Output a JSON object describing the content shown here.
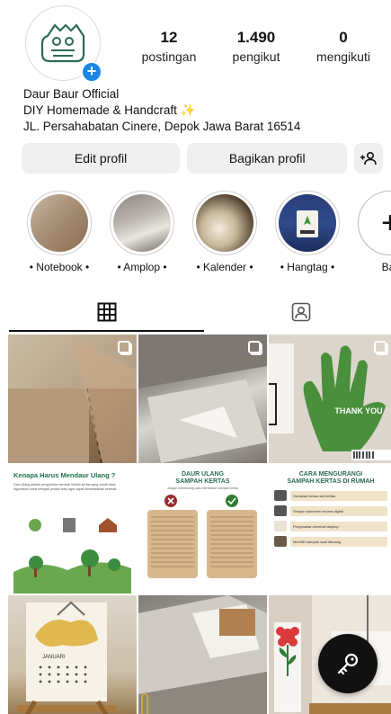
{
  "profile": {
    "name": "Daur Baur Official",
    "bio_line": "DIY Homemade & Handcraft",
    "bio_emoji": "✨",
    "address": "JL. Persahabatan Cinere, Depok Jawa Barat 16514"
  },
  "stats": [
    {
      "count": "12",
      "label": "postingan"
    },
    {
      "count": "1.490",
      "label": "pengikut"
    },
    {
      "count": "0",
      "label": "mengikuti"
    }
  ],
  "actions": {
    "edit_label": "Edit profil",
    "share_label": "Bagikan profil"
  },
  "highlights": [
    {
      "label": "• Notebook •"
    },
    {
      "label": "• Amplop •"
    },
    {
      "label": "• Kalender •"
    },
    {
      "label": "• Hangtag •"
    },
    {
      "label": "Bar"
    }
  ],
  "posts": {
    "post3_text": "THANK YOU",
    "post4": {
      "title": "Kenapa Harus Mendaur Ulang ?",
      "body": "Daur Ulang adalah pengolahan kembali limbah kertas yang sudah tidak digunakan untuk menjadi produk baru agar dapat dimanfaatkan kembali."
    },
    "post5": {
      "title_line1": "DAUR ULANG",
      "title_line2": "SAMPAH KERTAS",
      "subtitle": "Jangan membuang atau membakar sampah kertas"
    },
    "post6": {
      "title_line1": "CARA MENGURANGI",
      "title_line2": "SAMPAH KERTAS DI RUMAH",
      "items": [
        "Gunakan kedua sisi kertas",
        "Simpan dokumen secara digital",
        "Pergunakan kembali amplop",
        "Memilih sampah saat dibuang"
      ]
    },
    "post7_text": "JANUARI"
  },
  "colors": {
    "accent_blue": "#1a88e8",
    "button_bg": "#efefef",
    "green_brand": "#2d6b52"
  }
}
